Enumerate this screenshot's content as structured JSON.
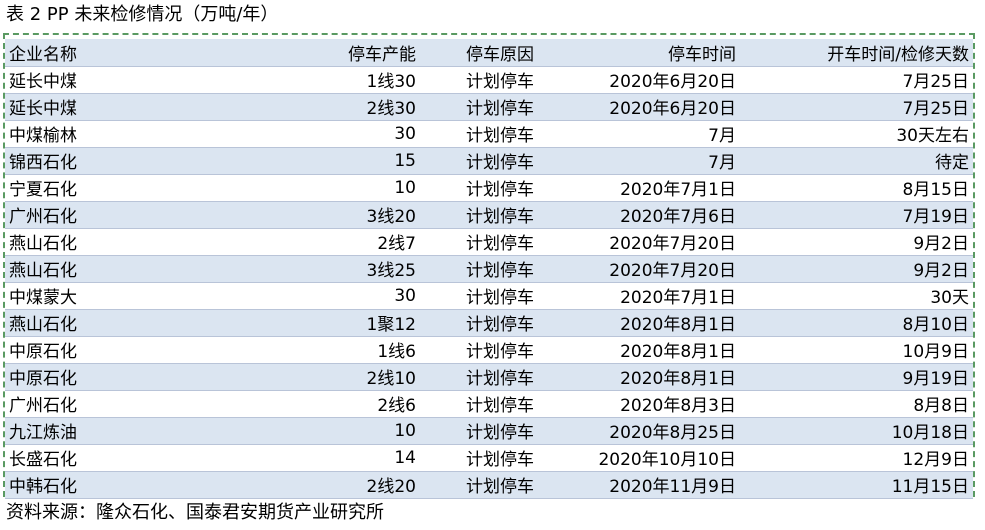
{
  "caption": "表 2  PP 未来检修情况（万吨/年）",
  "table": {
    "headers": [
      "企业名称",
      "停车产能",
      "停车原因",
      "停车时间",
      "开车时间/检修天数"
    ],
    "rows": [
      [
        "延长中煤",
        "1线30",
        "计划停车",
        "2020年6月20日",
        "7月25日"
      ],
      [
        "延长中煤",
        "2线30",
        "计划停车",
        "2020年6月20日",
        "7月25日"
      ],
      [
        "中煤榆林",
        "30",
        "计划停车",
        "7月",
        "30天左右"
      ],
      [
        "锦西石化",
        "15",
        "计划停车",
        "7月",
        "待定"
      ],
      [
        "宁夏石化",
        "10",
        "计划停车",
        "2020年7月1日",
        "8月15日"
      ],
      [
        "广州石化",
        "3线20",
        "计划停车",
        "2020年7月6日",
        "7月19日"
      ],
      [
        "燕山石化",
        "2线7",
        "计划停车",
        "2020年7月20日",
        "9月2日"
      ],
      [
        "燕山石化",
        "3线25",
        "计划停车",
        "2020年7月20日",
        "9月2日"
      ],
      [
        "中煤蒙大",
        "30",
        "计划停车",
        "2020年7月1日",
        "30天"
      ],
      [
        "燕山石化",
        "1聚12",
        "计划停车",
        "2020年8月1日",
        "8月10日"
      ],
      [
        "中原石化",
        "1线6",
        "计划停车",
        "2020年8月1日",
        "10月9日"
      ],
      [
        "中原石化",
        "2线10",
        "计划停车",
        "2020年8月1日",
        "9月19日"
      ],
      [
        "广州石化",
        "2线6",
        "计划停车",
        "2020年8月3日",
        "8月8日"
      ],
      [
        "九江炼油",
        "10",
        "计划停车",
        "2020年8月25日",
        "10月18日"
      ],
      [
        "长盛石化",
        "14",
        "计划停车",
        "2020年10月10日",
        "12月9日"
      ],
      [
        "中韩石化",
        "2线20",
        "计划停车",
        "2020年11月9日",
        "11月15日"
      ]
    ]
  },
  "source": "资料来源：隆众石化、国泰君安期货产业研究所",
  "colors": {
    "band": "#dbe5f1",
    "frame": "#5a9a62"
  }
}
